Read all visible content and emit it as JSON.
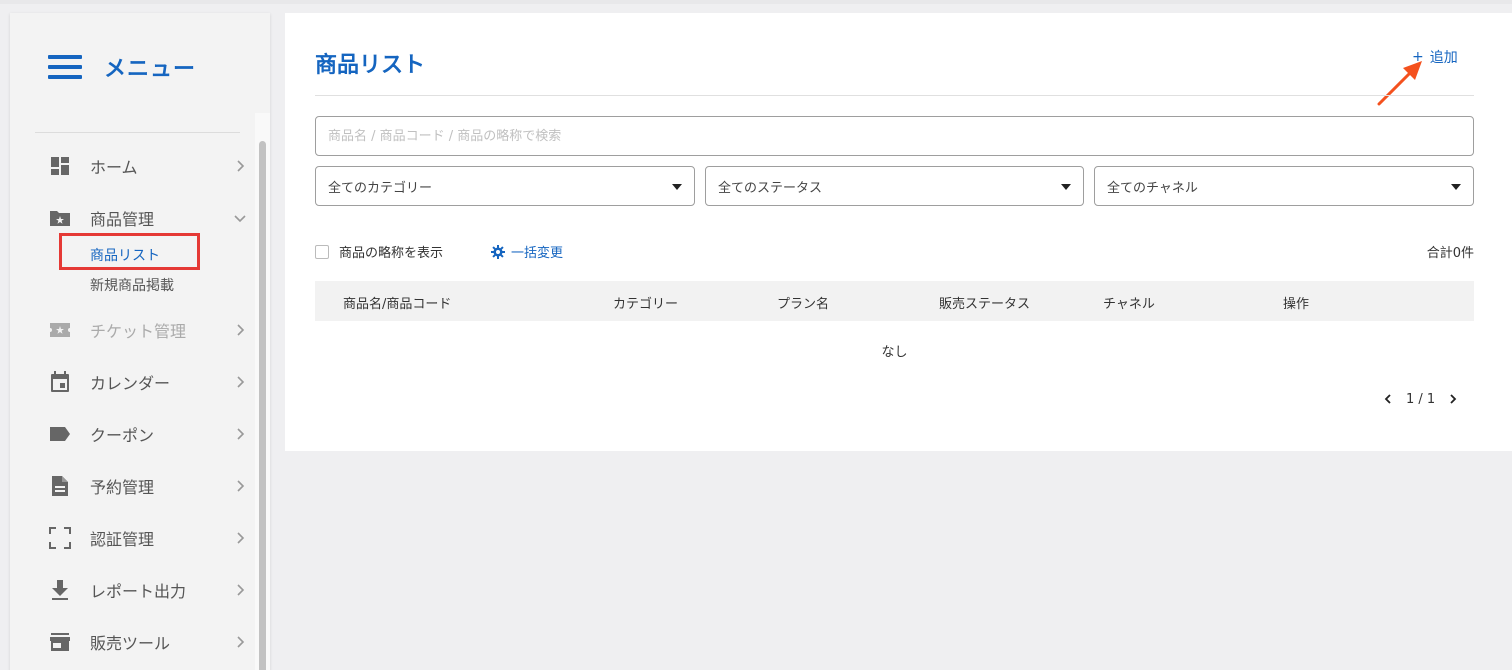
{
  "colors": {
    "accent": "#1565c0",
    "highlight": "#e53935",
    "arrow": "#f4511e"
  },
  "sidebar": {
    "menu_title": "メニュー",
    "items": [
      {
        "label": "ホーム",
        "icon": "dashboard-icon"
      },
      {
        "label": "商品管理",
        "icon": "folder-star-icon",
        "expanded": true,
        "children": [
          {
            "label": "商品リスト",
            "active": true
          },
          {
            "label": "新規商品掲載"
          }
        ]
      },
      {
        "label": "チケット管理",
        "icon": "ticket-icon",
        "disabled": true
      },
      {
        "label": "カレンダー",
        "icon": "calendar-icon"
      },
      {
        "label": "クーポン",
        "icon": "tag-icon"
      },
      {
        "label": "予約管理",
        "icon": "document-icon"
      },
      {
        "label": "認証管理",
        "icon": "scan-frame-icon"
      },
      {
        "label": "レポート出力",
        "icon": "download-icon"
      },
      {
        "label": "販売ツール",
        "icon": "store-icon"
      }
    ]
  },
  "main": {
    "title": "商品リスト",
    "add_label": "追加",
    "search_placeholder": "商品名 / 商品コード / 商品の略称で検索",
    "filters": [
      "全てのカテゴリー",
      "全てのステータス",
      "全てのチャネル"
    ],
    "show_abbrev_label": "商品の略称を表示",
    "bulk_edit_label": "一括変更",
    "total_label": "合計0件",
    "table": {
      "columns": [
        "商品名/商品コード",
        "カテゴリー",
        "プラン名",
        "販売ステータス",
        "チャネル",
        "操作"
      ],
      "empty_text": "なし"
    },
    "pagination": {
      "text": "1 / 1"
    }
  }
}
